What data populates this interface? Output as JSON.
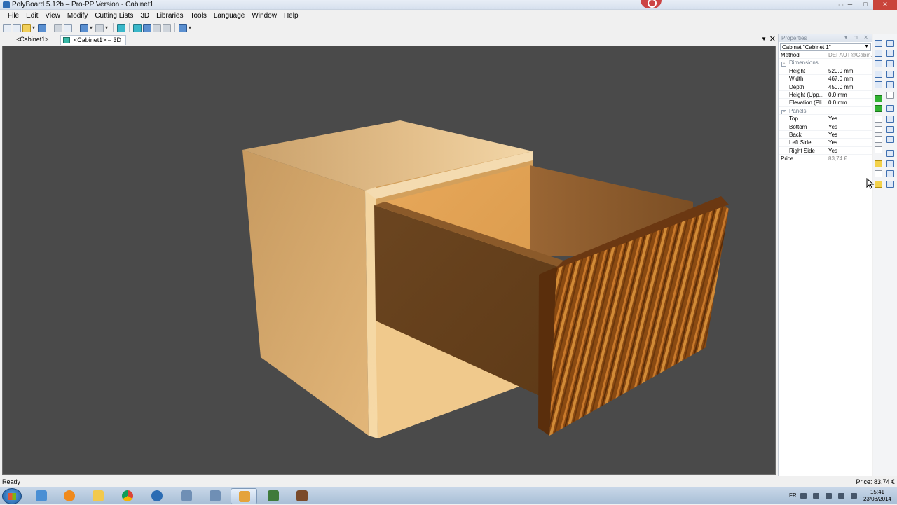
{
  "window": {
    "title": "PolyBoard 5.12b – Pro-PP Version - Cabinet1"
  },
  "menu": [
    {
      "label": "File"
    },
    {
      "label": "Edit"
    },
    {
      "label": "View"
    },
    {
      "label": "Modify"
    },
    {
      "label": "Cutting Lists"
    },
    {
      "label": "3D"
    },
    {
      "label": "Libraries"
    },
    {
      "label": "Tools"
    },
    {
      "label": "Language"
    },
    {
      "label": "Window"
    },
    {
      "label": "Help"
    }
  ],
  "tabs": {
    "tab1": "<Cabinet1>",
    "tab2": "<Cabinet1> – 3D"
  },
  "properties": {
    "header": "Properties",
    "selector": "Cabinet \"Cabinet 1\"",
    "method_label": "Method",
    "method_value": "DEFAUT@Cabin...",
    "dimensions_group": "Dimensions",
    "height_label": "Height",
    "height_value": "520.0 mm",
    "width_label": "Width",
    "width_value": "467.0 mm",
    "depth_label": "Depth",
    "depth_value": "450.0 mm",
    "height_upp_label": "Height (Upp...",
    "height_upp_value": "0.0 mm",
    "elevation_label": "Elevation (Pli...",
    "elevation_value": "0.0 mm",
    "panels_group": "Panels",
    "top_label": "Top",
    "top_value": "Yes",
    "bottom_label": "Bottom",
    "bottom_value": "Yes",
    "back_label": "Back",
    "back_value": "Yes",
    "left_label": "Left Side",
    "left_value": "Yes",
    "right_label": "Right Side",
    "right_value": "Yes",
    "price_label": "Price",
    "price_value": "83,74 €"
  },
  "status": {
    "left": "Ready",
    "right": "Price: 83,74 €"
  },
  "taskbar": {
    "lang": "FR",
    "time": "15:41",
    "date": "23/08/2014"
  },
  "colors": {
    "viewport_bg": "#4a4a4a",
    "carcass": "#e6b87a",
    "drawer_front": "#8c4c14"
  }
}
